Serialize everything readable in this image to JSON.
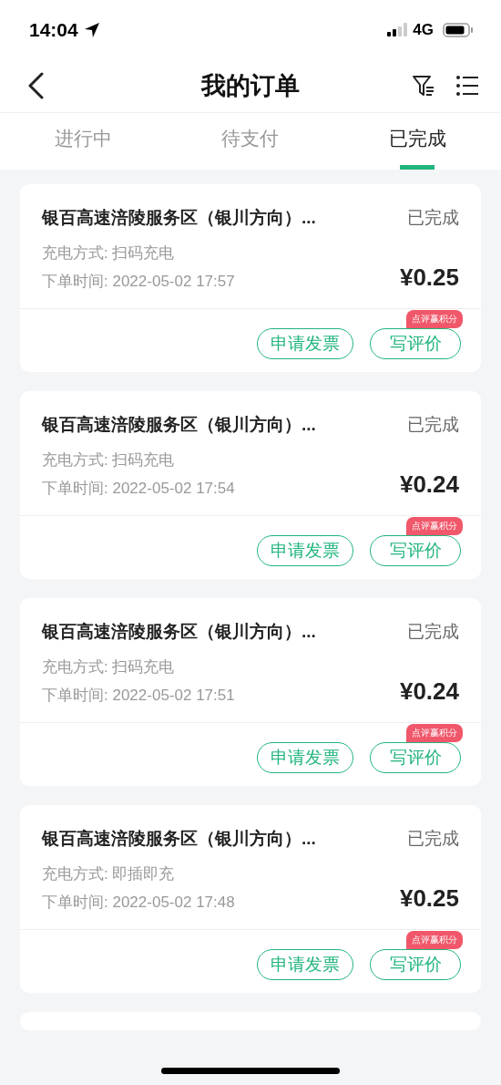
{
  "status_bar": {
    "time": "14:04",
    "network": "4G"
  },
  "nav": {
    "title": "我的订单"
  },
  "tabs": [
    {
      "label": "进行中",
      "selected": false
    },
    {
      "label": "待支付",
      "selected": false
    },
    {
      "label": "已完成",
      "selected": true
    }
  ],
  "orders": [
    {
      "station": "银百高速涪陵服务区（银川方向）...",
      "status": "已完成",
      "method": "充电方式: 扫码充电",
      "time": "下单时间: 2022-05-02 17:57",
      "amount": "¥0.25",
      "badge": "点评赢积分",
      "buttons": [
        "申请发票",
        "写评价"
      ]
    },
    {
      "station": "银百高速涪陵服务区（银川方向）...",
      "status": "已完成",
      "method": "充电方式: 扫码充电",
      "time": "下单时间: 2022-05-02 17:54",
      "amount": "¥0.24",
      "badge": "点评赢积分",
      "buttons": [
        "申请发票",
        "写评价"
      ]
    },
    {
      "station": "银百高速涪陵服务区（银川方向）...",
      "status": "已完成",
      "method": "充电方式: 扫码充电",
      "time": "下单时间: 2022-05-02 17:51",
      "amount": "¥0.24",
      "badge": "点评赢积分",
      "buttons": [
        "申请发票",
        "写评价"
      ]
    },
    {
      "station": "银百高速涪陵服务区（银川方向）...",
      "status": "已完成",
      "method": "充电方式: 即插即充",
      "time": "下单时间: 2022-05-02 17:48",
      "amount": "¥0.25",
      "badge": "点评赢积分",
      "buttons": [
        "申请发票",
        "写评价"
      ]
    }
  ]
}
